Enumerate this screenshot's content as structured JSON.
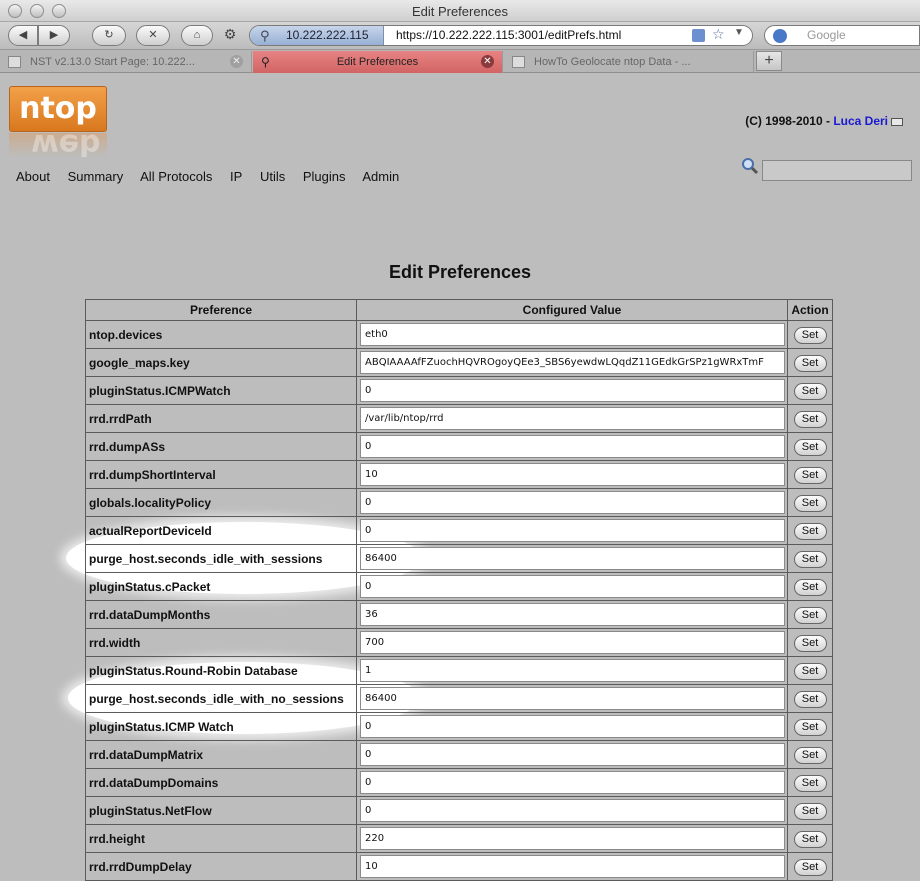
{
  "window": {
    "title": "Edit Preferences"
  },
  "toolbar": {
    "back": "◀",
    "forward": "▶",
    "reload": "↻",
    "stop": "✕",
    "home": "⌂",
    "url_host": "10.222.222.115",
    "url": "https://10.222.222.115:3001/editPrefs.html",
    "search_placeholder": "Google"
  },
  "tabs": [
    {
      "label": "NST v2.13.0 Start Page: 10.222...",
      "active": false
    },
    {
      "label": "Edit Preferences",
      "active": true
    },
    {
      "label": "HowTo Geolocate ntop Data - ...",
      "active": false
    }
  ],
  "header": {
    "logo_text": "ntop",
    "copyright": "(C) 1998-2010 - ",
    "author": "Luca Deri"
  },
  "menu": [
    "About",
    "Summary",
    "All Protocols",
    "IP",
    "Utils",
    "Plugins",
    "Admin"
  ],
  "page": {
    "title": "Edit Preferences",
    "columns": [
      "Preference",
      "Configured Value",
      "Action"
    ],
    "set_label": "Set"
  },
  "rows": [
    {
      "name": "ntop.devices",
      "value": "eth0"
    },
    {
      "name": "google_maps.key",
      "value": "ABQIAAAAfFZuochHQVROgoyQEe3_SBS6yewdwLQqdZ11GEdkGrSPz1gWRxTmF"
    },
    {
      "name": "pluginStatus.ICMPWatch",
      "value": "0"
    },
    {
      "name": "rrd.rrdPath",
      "value": "/var/lib/ntop/rrd"
    },
    {
      "name": "rrd.dumpASs",
      "value": "0"
    },
    {
      "name": "rrd.dumpShortInterval",
      "value": "10"
    },
    {
      "name": "globals.localityPolicy",
      "value": "0"
    },
    {
      "name": "actualReportDeviceId",
      "value": "0"
    },
    {
      "name": "purge_host.seconds_idle_with_sessions",
      "value": "86400",
      "highlight": true
    },
    {
      "name": "pluginStatus.cPacket",
      "value": "0"
    },
    {
      "name": "rrd.dataDumpMonths",
      "value": "36"
    },
    {
      "name": "rrd.width",
      "value": "700"
    },
    {
      "name": "pluginStatus.Round-Robin Database",
      "value": "1"
    },
    {
      "name": "purge_host.seconds_idle_with_no_sessions",
      "value": "86400",
      "highlight": true
    },
    {
      "name": "pluginStatus.ICMP Watch",
      "value": "0"
    },
    {
      "name": "rrd.dataDumpMatrix",
      "value": "0"
    },
    {
      "name": "rrd.dataDumpDomains",
      "value": "0"
    },
    {
      "name": "pluginStatus.NetFlow",
      "value": "0"
    },
    {
      "name": "rrd.height",
      "value": "220"
    },
    {
      "name": "rrd.rrdDumpDelay",
      "value": "10"
    }
  ]
}
